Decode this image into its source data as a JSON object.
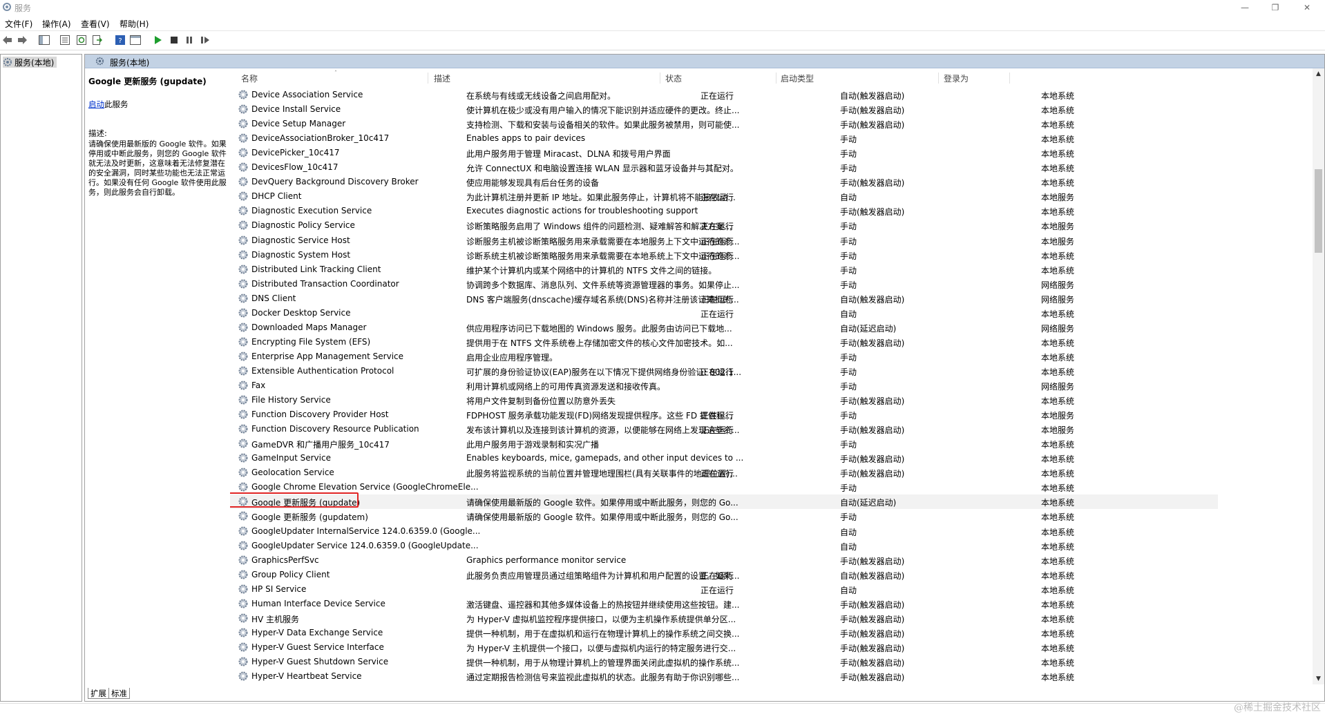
{
  "window": {
    "title": "服务",
    "min": "—",
    "restore": "❐",
    "close": "✕"
  },
  "menu": [
    "文件(F)",
    "操作(A)",
    "查看(V)",
    "帮助(H)"
  ],
  "toolbar": {
    "icons": [
      "back-icon",
      "forward-icon",
      "show-tree-icon",
      "properties-icon",
      "refresh-icon",
      "export-icon",
      "help-icon",
      "view-icon",
      "start-service-icon",
      "stop-service-icon",
      "pause-service-icon",
      "resume-service-icon"
    ]
  },
  "tree": {
    "root": "服务(本地)"
  },
  "pane": {
    "header": "服务(本地)"
  },
  "details": {
    "service_name": "Google 更新服务 (gupdate)",
    "start_link": "启动",
    "start_suffix": "此服务",
    "desc_label": "描述:",
    "desc_text": "请确保使用最新版的 Google 软件。如果停用或中断此服务，则您的 Google 软件就无法及时更新，这意味着无法修复潜在的安全漏洞，同时某些功能也无法正常运行。如果没有任何 Google 软件使用此服务，则此服务会自行卸载。"
  },
  "columns": {
    "name": "名称",
    "desc": "描述",
    "status": "状态",
    "startup": "启动类型",
    "logon": "登录为"
  },
  "rows": [
    {
      "name": "Device Association Service",
      "desc": "在系统与有线或无线设备之间启用配对。",
      "status": "正在运行",
      "startup": "自动(触发器启动)",
      "logon": "本地系统"
    },
    {
      "name": "Device Install Service",
      "desc": "使计算机在极少或没有用户输入的情况下能识别并适应硬件的更改。终止...",
      "status": "",
      "startup": "手动(触发器启动)",
      "logon": "本地系统"
    },
    {
      "name": "Device Setup Manager",
      "desc": "支持检测、下载和安装与设备相关的软件。如果此服务被禁用，则可能使...",
      "status": "",
      "startup": "手动(触发器启动)",
      "logon": "本地系统"
    },
    {
      "name": "DeviceAssociationBroker_10c417",
      "desc": "Enables apps to pair devices",
      "status": "",
      "startup": "手动",
      "logon": "本地系统"
    },
    {
      "name": "DevicePicker_10c417",
      "desc": "此用户服务用于管理 Miracast、DLNA 和拨号用户界面",
      "status": "",
      "startup": "手动",
      "logon": "本地系统"
    },
    {
      "name": "DevicesFlow_10c417",
      "desc": "允许 ConnectUX 和电脑设置连接 WLAN 显示器和蓝牙设备并与其配对。",
      "status": "",
      "startup": "手动",
      "logon": "本地系统"
    },
    {
      "name": "DevQuery Background Discovery Broker",
      "desc": "使应用能够发现具有后台任务的设备",
      "status": "",
      "startup": "手动(触发器启动)",
      "logon": "本地系统"
    },
    {
      "name": "DHCP Client",
      "desc": "为此计算机注册并更新 IP 地址。如果此服务停止，计算机将不能接收动...",
      "status": "正在运行",
      "startup": "自动",
      "logon": "本地服务"
    },
    {
      "name": "Diagnostic Execution Service",
      "desc": "Executes diagnostic actions for troubleshooting support",
      "status": "",
      "startup": "手动(触发器启动)",
      "logon": "本地系统"
    },
    {
      "name": "Diagnostic Policy Service",
      "desc": "诊断策略服务启用了 Windows 组件的问题检测、疑难解答和解决方案...",
      "status": "正在运行",
      "startup": "手动",
      "logon": "本地服务"
    },
    {
      "name": "Diagnostic Service Host",
      "desc": "诊断服务主机被诊断策略服务用来承载需要在本地服务上下文中运行的诊...",
      "status": "正在运行",
      "startup": "手动",
      "logon": "本地服务"
    },
    {
      "name": "Diagnostic System Host",
      "desc": "诊断系统主机被诊断策略服务用来承载需要在本地系统上下文中运行的诊...",
      "status": "正在运行",
      "startup": "手动",
      "logon": "本地系统"
    },
    {
      "name": "Distributed Link Tracking Client",
      "desc": "维护某个计算机内或某个网络中的计算机的 NTFS 文件之间的链接。",
      "status": "",
      "startup": "手动",
      "logon": "本地系统"
    },
    {
      "name": "Distributed Transaction Coordinator",
      "desc": "协调跨多个数据库、消息队列、文件系统等资源管理器的事务。如果停止...",
      "status": "",
      "startup": "手动",
      "logon": "网络服务"
    },
    {
      "name": "DNS Client",
      "desc": "DNS 客户端服务(dnscache)缓存域名系统(DNS)名称并注册该计算机的...",
      "status": "正在运行",
      "startup": "自动(触发器启动)",
      "logon": "网络服务"
    },
    {
      "name": "Docker Desktop Service",
      "desc": "",
      "status": "正在运行",
      "startup": "自动",
      "logon": "本地系统"
    },
    {
      "name": "Downloaded Maps Manager",
      "desc": "供应用程序访问已下载地图的 Windows 服务。此服务由访问已下载地...",
      "status": "",
      "startup": "自动(延迟启动)",
      "logon": "网络服务"
    },
    {
      "name": "Encrypting File System (EFS)",
      "desc": "提供用于在 NTFS 文件系统卷上存储加密文件的核心文件加密技术。如...",
      "status": "",
      "startup": "手动(触发器启动)",
      "logon": "本地系统"
    },
    {
      "name": "Enterprise App Management Service",
      "desc": "启用企业应用程序管理。",
      "status": "",
      "startup": "手动",
      "logon": "本地系统"
    },
    {
      "name": "Extensible Authentication Protocol",
      "desc": "可扩展的身份验证协议(EAP)服务在以下情况下提供网络身份验证: 802.1...",
      "status": "正在运行",
      "startup": "手动",
      "logon": "本地系统"
    },
    {
      "name": "Fax",
      "desc": "利用计算机或网络上的可用传真资源发送和接收传真。",
      "status": "",
      "startup": "手动",
      "logon": "网络服务"
    },
    {
      "name": "File History Service",
      "desc": "将用户文件复制到备份位置以防意外丢失",
      "status": "",
      "startup": "手动(触发器启动)",
      "logon": "本地系统"
    },
    {
      "name": "Function Discovery Provider Host",
      "desc": "FDPHOST 服务承载功能发现(FD)网络发现提供程序。这些 FD 提供程...",
      "status": "正在运行",
      "startup": "手动",
      "logon": "本地服务"
    },
    {
      "name": "Function Discovery Resource Publication",
      "desc": "发布该计算机以及连接到该计算机的资源，以便能够在网络上发现这些资...",
      "status": "正在运行",
      "startup": "手动(触发器启动)",
      "logon": "本地服务"
    },
    {
      "name": "GameDVR 和广播用户服务_10c417",
      "desc": "此用户服务用于游戏录制和实况广播",
      "status": "",
      "startup": "手动",
      "logon": "本地系统"
    },
    {
      "name": "GameInput Service",
      "desc": "Enables keyboards, mice, gamepads, and other input devices to ...",
      "status": "",
      "startup": "手动(触发器启动)",
      "logon": "本地系统"
    },
    {
      "name": "Geolocation Service",
      "desc": "此服务将监视系统的当前位置并管理地理围栏(具有关联事件的地理位置)...",
      "status": "正在运行",
      "startup": "手动(触发器启动)",
      "logon": "本地系统"
    },
    {
      "name": "Google Chrome Elevation Service (GoogleChromeEle...",
      "desc": "",
      "status": "",
      "startup": "手动",
      "logon": "本地系统"
    },
    {
      "name": "Google 更新服务 (gupdate)",
      "desc": "请确保使用最新版的 Google 软件。如果停用或中断此服务，则您的 Go...",
      "status": "",
      "startup": "自动(延迟启动)",
      "logon": "本地系统",
      "selected": true
    },
    {
      "name": "Google 更新服务 (gupdatem)",
      "desc": "请确保使用最新版的 Google 软件。如果停用或中断此服务，则您的 Go...",
      "status": "",
      "startup": "手动",
      "logon": "本地系统"
    },
    {
      "name": "GoogleUpdater InternalService 124.0.6359.0 (Google...",
      "desc": "",
      "status": "",
      "startup": "自动",
      "logon": "本地系统"
    },
    {
      "name": "GoogleUpdater Service 124.0.6359.0 (GoogleUpdate...",
      "desc": "",
      "status": "",
      "startup": "自动",
      "logon": "本地系统"
    },
    {
      "name": "GraphicsPerfSvc",
      "desc": "Graphics performance monitor service",
      "status": "",
      "startup": "手动(触发器启动)",
      "logon": "本地系统"
    },
    {
      "name": "Group Policy Client",
      "desc": "此服务负责应用管理员通过组策略组件为计算机和用户配置的设置。如果...",
      "status": "正在运行",
      "startup": "自动(触发器启动)",
      "logon": "本地系统"
    },
    {
      "name": "HP SI Service",
      "desc": "",
      "status": "正在运行",
      "startup": "自动",
      "logon": "本地系统"
    },
    {
      "name": "Human Interface Device Service",
      "desc": "激活键盘、遥控器和其他多媒体设备上的热按钮并继续使用这些按钮。建...",
      "status": "",
      "startup": "手动(触发器启动)",
      "logon": "本地系统"
    },
    {
      "name": "HV 主机服务",
      "desc": "为 Hyper-V 虚拟机监控程序提供接口，以便为主机操作系统提供单分区...",
      "status": "",
      "startup": "手动(触发器启动)",
      "logon": "本地系统"
    },
    {
      "name": "Hyper-V Data Exchange Service",
      "desc": "提供一种机制，用于在虚拟机和运行在物理计算机上的操作系统之间交换...",
      "status": "",
      "startup": "手动(触发器启动)",
      "logon": "本地系统"
    },
    {
      "name": "Hyper-V Guest Service Interface",
      "desc": "为 Hyper-V 主机提供一个接口，以便与虚拟机内运行的特定服务进行交...",
      "status": "",
      "startup": "手动(触发器启动)",
      "logon": "本地系统"
    },
    {
      "name": "Hyper-V Guest Shutdown Service",
      "desc": "提供一种机制，用于从物理计算机上的管理界面关闭此虚拟机的操作系统...",
      "status": "",
      "startup": "手动(触发器启动)",
      "logon": "本地系统"
    },
    {
      "name": "Hyper-V Heartbeat Service",
      "desc": "通过定期报告检测信号来监视此虚拟机的状态。此服务有助于你识别哪些...",
      "status": "",
      "startup": "手动(触发器启动)",
      "logon": "本地系统"
    }
  ],
  "tabs": [
    "扩展",
    "标准"
  ],
  "watermark": "@稀土掘金技术社区"
}
